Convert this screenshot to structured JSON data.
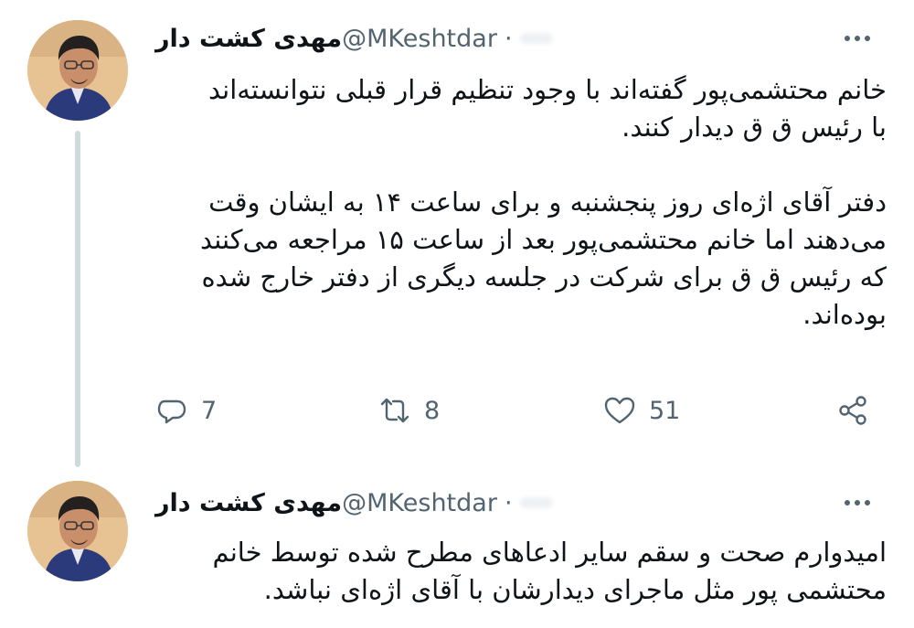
{
  "tweets": [
    {
      "author_name": "مهدی کشت دار",
      "handle": "@MKeshtdar",
      "separator": "·",
      "avatar": "profile-photo",
      "more_icon": "more-dots-icon",
      "text": "خانم محتشمی‌پور گفته‌اند با وجود تنظیم قرار قبلی نتوانسته‌اند\nبا رئیس ق ق دیدار کنند.\n\nدفتر آقای اژه‌ای روز پنجشنبه و برای ساعت ۱۴ به ایشان وقت\nمی‌دهند اما خانم محتشمی‌پور بعد از ساعت ۱۵ مراجعه می‌کنند\nکه رئیس ق ق برای شرکت در جلسه دیگری از دفتر خارج شده\nبوده‌اند.",
      "replies": "7",
      "retweets": "8",
      "likes": "51"
    },
    {
      "author_name": "مهدی کشت دار",
      "handle": "@MKeshtdar",
      "separator": "·",
      "avatar": "profile-photo",
      "more_icon": "more-dots-icon",
      "text": "امیدوارم صحت و سقم سایر ادعاهای مطرح شده توسط خانم\nمحتشمی پور مثل ماجرای دیدارشان با آقای اژه‌ای نباشد."
    }
  ],
  "icons": {
    "reply": "reply-bubble-icon",
    "retweet": "retweet-arrows-icon",
    "like": "heart-icon",
    "share": "share-nodes-icon"
  },
  "colors": {
    "text": "#0f1419",
    "secondary": "#536471",
    "thread_line": "#cfd9de"
  }
}
